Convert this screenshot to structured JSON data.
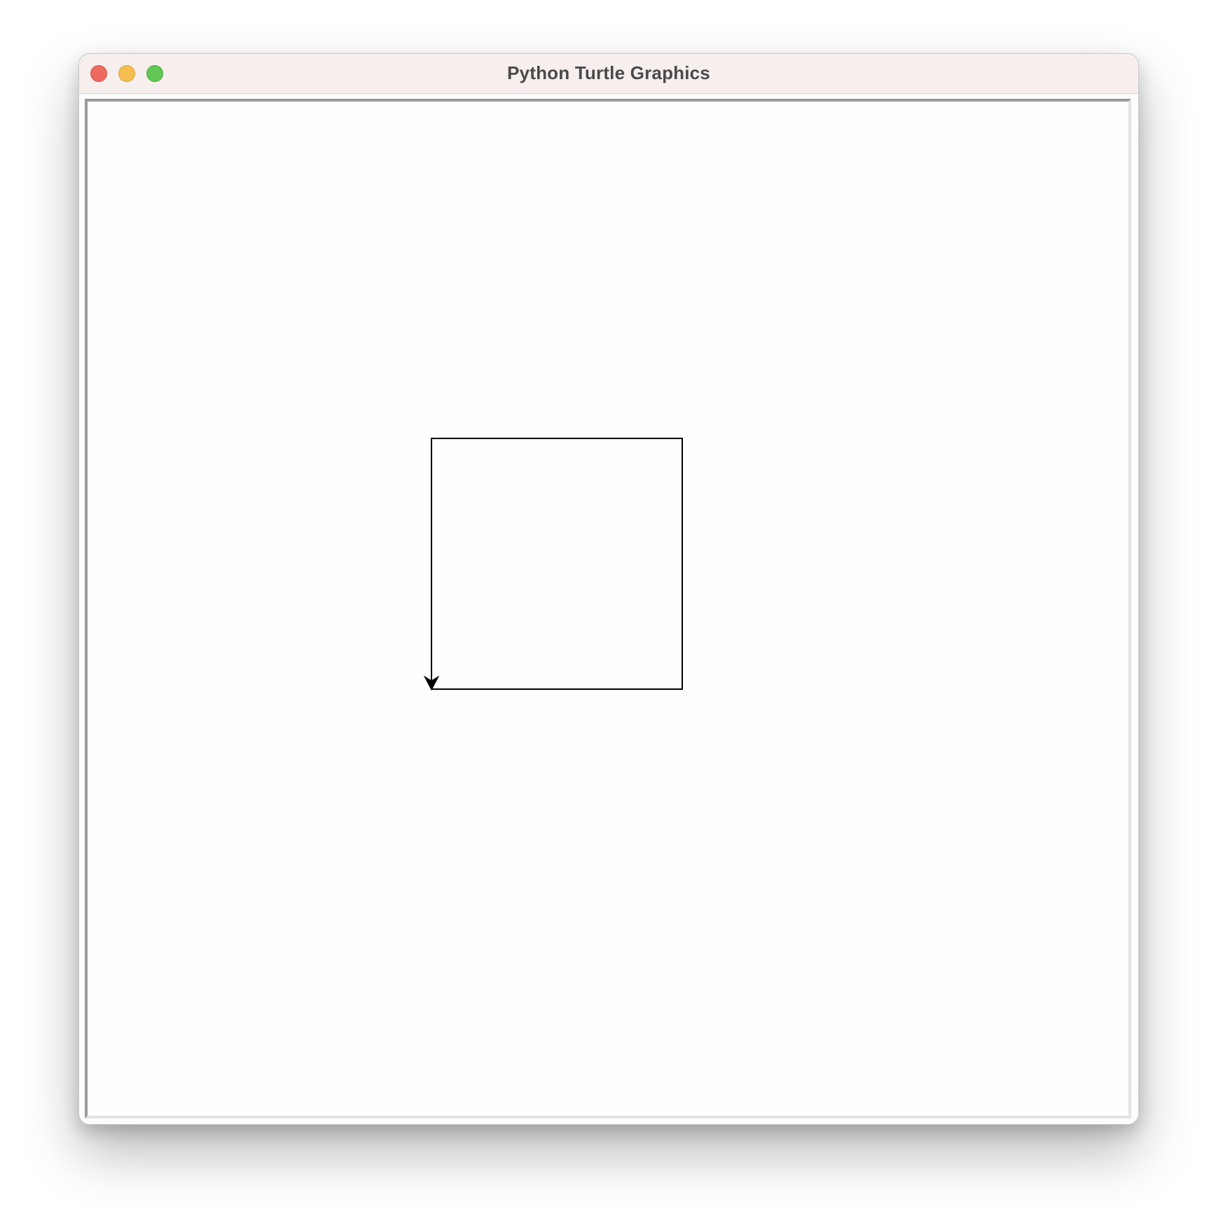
{
  "window": {
    "title": "Python Turtle Graphics"
  },
  "colors": {
    "titlebar": "#f6efed",
    "close": "#ee6a5e",
    "minimize": "#f6be4f",
    "zoom": "#62c654",
    "canvas": "#fefefe",
    "pen": "#000000"
  },
  "icons": {
    "close": "close-button-icon",
    "minimize": "minimize-button-icon",
    "zoom": "zoom-button-icon",
    "turtle": "turtle-arrow-icon"
  },
  "turtle": {
    "shape": "classic",
    "heading": "down",
    "pen_color": "#000000"
  }
}
